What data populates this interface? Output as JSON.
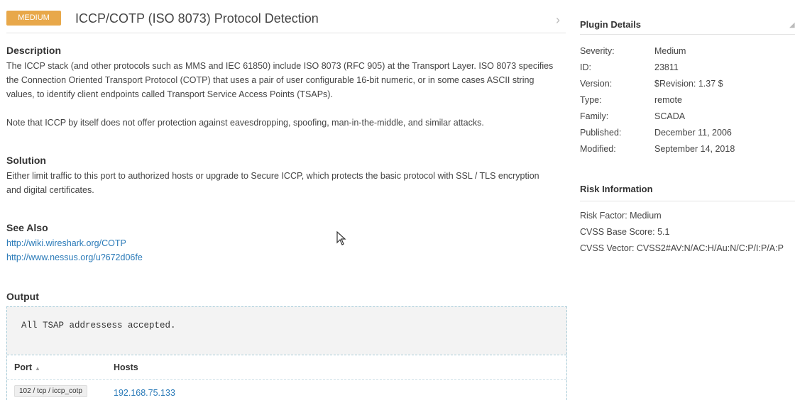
{
  "header": {
    "severity_badge": "MEDIUM",
    "title": "ICCP/COTP (ISO 8073) Protocol Detection",
    "badge_color": "#e8a84a"
  },
  "description": {
    "heading": "Description",
    "line1": "The ICCP stack (and other protocols such as MMS and IEC 61850) include ISO 8073 (RFC 905) at the Transport Layer. ISO 8073 specifies",
    "line2": "the Connection Oriented Transport Protocol (COTP) that uses a pair of user configurable 16-bit numeric, or in some cases ASCII string",
    "line3": "values, to identify client endpoints called Transport Service Access Points (TSAPs).",
    "note": "Note that ICCP by itself does not offer protection against eavesdropping, spoofing, man-in-the-middle, and similar attacks."
  },
  "solution": {
    "heading": "Solution",
    "line1": "Either limit traffic to this port to authorized hosts or upgrade to Secure ICCP, which protects the basic protocol with SSL / TLS encryption",
    "line2": "and digital certificates."
  },
  "see_also": {
    "heading": "See Also",
    "links": [
      "http://wiki.wireshark.org/COTP",
      "http://www.nessus.org/u?672d06fe"
    ]
  },
  "output": {
    "heading": "Output",
    "text": "All TSAP addressess accepted.",
    "columns": [
      "Port",
      "Hosts"
    ],
    "rows": [
      {
        "port": "102 / tcp / iccp_cotp",
        "host": "192.168.75.133"
      }
    ]
  },
  "plugin_details": {
    "heading": "Plugin Details",
    "items": [
      {
        "key": "Severity:",
        "value": "Medium"
      },
      {
        "key": "ID:",
        "value": "23811"
      },
      {
        "key": "Version:",
        "value": "$Revision: 1.37 $"
      },
      {
        "key": "Type:",
        "value": "remote"
      },
      {
        "key": "Family:",
        "value": "SCADA"
      },
      {
        "key": "Published:",
        "value": "December 11, 2006"
      },
      {
        "key": "Modified:",
        "value": "September 14, 2018"
      }
    ]
  },
  "risk_information": {
    "heading": "Risk Information",
    "lines": [
      "Risk Factor: Medium",
      "CVSS Base Score: 5.1",
      "CVSS Vector: CVSS2#AV:N/AC:H/Au:N/C:P/I:P/A:P"
    ]
  },
  "icons": {
    "next": "chevron-right-icon",
    "sort": "sort-asc-icon",
    "cursor": "mouse-cursor-icon"
  }
}
